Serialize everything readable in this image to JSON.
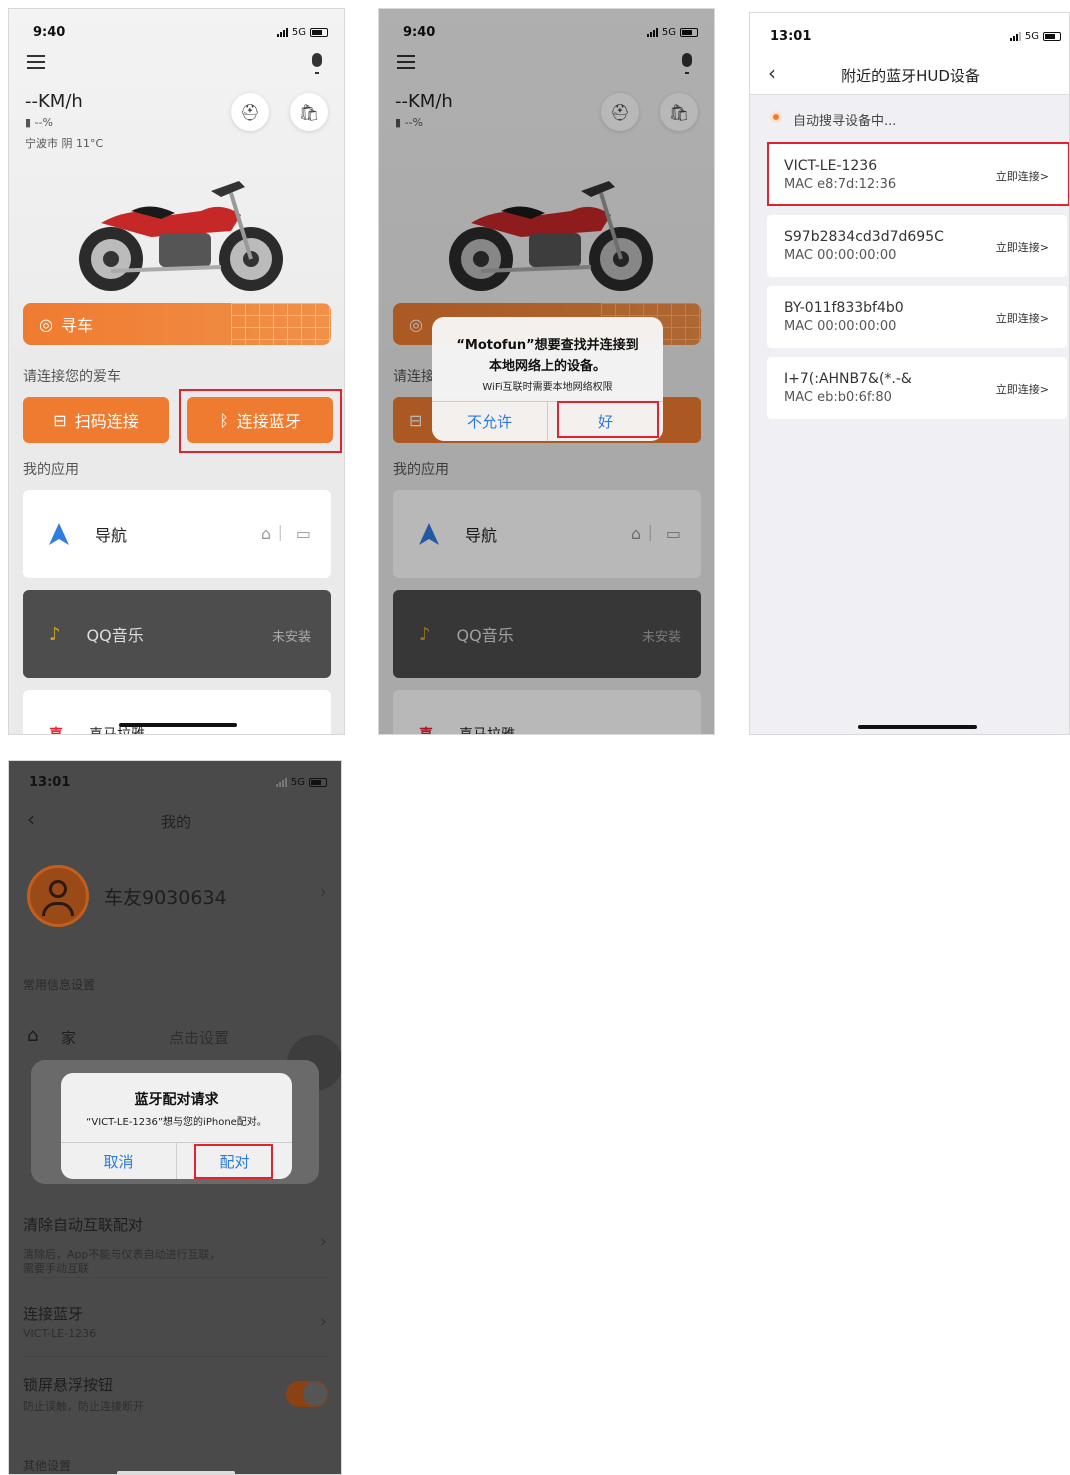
{
  "colors": {
    "accent": "#ef7b30",
    "highlight": "#e0232e",
    "ios_blue": "#2a7ae2"
  },
  "screen1": {
    "time": "9:40",
    "network": "5G",
    "speed": "--KM/h",
    "fuel": "--%",
    "weather": "宁波市 阴 11°C",
    "find_car": "寻车",
    "connect_prompt": "请连接您的爱车",
    "scan_connect": "扫码连接",
    "bt_connect": "连接蓝牙",
    "my_apps": "我的应用",
    "app_nav": "导航",
    "app_qq": "QQ音乐",
    "app_qq_status": "未安装",
    "app_partial": "喜马拉雅"
  },
  "screen2": {
    "time": "9:40",
    "network": "5G",
    "speed": "--KM/h",
    "fuel": "--%",
    "connect_prompt": "请连接",
    "alert_title_1": "“Motofun”想要查找并连接到",
    "alert_title_2": "本地网络上的设备。",
    "alert_msg": "WiFi互联时需要本地网络权限",
    "deny": "不允许",
    "ok": "好",
    "my_apps": "我的应用",
    "app_nav": "导航",
    "app_qq": "QQ音乐",
    "app_qq_status": "未安装",
    "app_partial": "喜马拉雅"
  },
  "screen3": {
    "time": "13:01",
    "network": "5G",
    "title": "附近的蓝牙HUD设备",
    "searching": "自动搜寻设备中...",
    "connect_label": "立即连接>",
    "devices": [
      {
        "name": "VICT-LE-1236",
        "mac": "MAC e8:7d:12:36"
      },
      {
        "name": "S97b2834cd3d7d695C",
        "mac": "MAC 00:00:00:00"
      },
      {
        "name": "BY-011f833bf4b0",
        "mac": "MAC 00:00:00:00"
      },
      {
        "name": "I+7(:AHNB7&(*.-&",
        "mac": "MAC eb:b0:6f:80"
      }
    ]
  },
  "screen4": {
    "time": "13:01",
    "network": "5G",
    "title": "我的",
    "username": "车友9030634",
    "section_common": "常用信息设置",
    "home_label": "家",
    "home_value": "点击设置",
    "alert_title": "蓝牙配对请求",
    "alert_msg": "“VICT-LE-1236”想与您的iPhone配对。",
    "cancel": "取消",
    "pair": "配对",
    "clear_auto": "清除自动互联配对",
    "clear_auto_desc_1": "清除后，App不能与仪表自动进行互联，",
    "clear_auto_desc_2": "需要手动互联",
    "connect_bt": "连接蓝牙",
    "connect_bt_value": "VICT-LE-1236",
    "lock_float": "锁屏悬浮按钮",
    "lock_float_desc": "防止误触，防止连接断开",
    "other_settings": "其他设置"
  }
}
